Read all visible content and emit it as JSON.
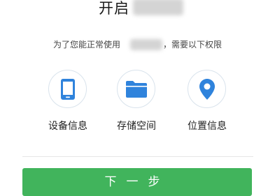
{
  "header": {
    "title": "开启"
  },
  "notice": {
    "prefix": "为了您能正常使用",
    "suffix": "，需要以下权限"
  },
  "permissions": [
    {
      "icon": "phone-icon",
      "label": "设备信息"
    },
    {
      "icon": "folder-icon",
      "label": "存储空间"
    },
    {
      "icon": "location-pin-icon",
      "label": "位置信息"
    }
  ],
  "actions": {
    "next_label": "下一步"
  },
  "colors": {
    "accent": "#2f83dc",
    "button": "#41b45c",
    "circle_border": "#d9e3ec"
  }
}
